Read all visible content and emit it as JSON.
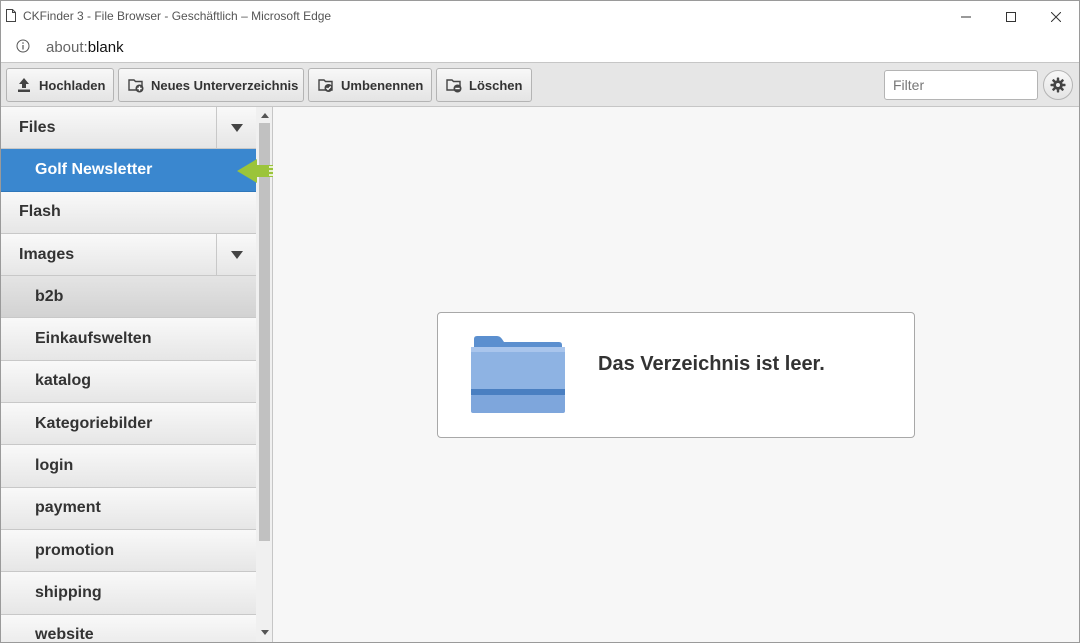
{
  "window": {
    "title": "CKFinder 3 - File Browser - Geschäftlich – Microsoft Edge",
    "address_scheme": "about:",
    "address_path": "blank"
  },
  "toolbar": {
    "upload_label": "Hochladen",
    "new_folder_label": "Neues Unterverzeichnis",
    "rename_label": "Umbenennen",
    "delete_label": "Löschen",
    "filter_placeholder": "Filter"
  },
  "sidebar": {
    "items": [
      {
        "label": "Files",
        "level": "root"
      },
      {
        "label": "Golf Newsletter",
        "level": "child",
        "selected": true
      },
      {
        "label": "Flash",
        "level": "root"
      },
      {
        "label": "Images",
        "level": "root"
      },
      {
        "label": "b2b",
        "level": "child"
      },
      {
        "label": "Einkaufswelten",
        "level": "child"
      },
      {
        "label": "katalog",
        "level": "child"
      },
      {
        "label": "Kategoriebilder",
        "level": "child"
      },
      {
        "label": "login",
        "level": "child"
      },
      {
        "label": "payment",
        "level": "child"
      },
      {
        "label": "promotion",
        "level": "child"
      },
      {
        "label": "shipping",
        "level": "child"
      },
      {
        "label": "website",
        "level": "child"
      }
    ]
  },
  "main": {
    "empty_message": "Das Verzeichnis ist leer."
  },
  "colors": {
    "selected": "#3a87cf",
    "callout": "#9bc43a",
    "folder": "#6f9fd8"
  }
}
